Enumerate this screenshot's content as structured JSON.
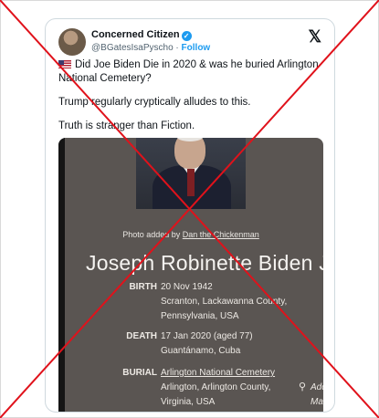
{
  "tweet": {
    "display_name": "Concerned Citizen",
    "handle": "@BGatesIsaPyscho",
    "separator": "·",
    "follow_label": "Follow",
    "lines": [
      "Did Joe Biden Die in 2020 & was he buried Arlington National Cemetery?",
      "Trump regularly cryptically alludes to this.",
      "Truth is stranger than Fiction."
    ]
  },
  "embed": {
    "photo_credit_prefix": "Photo added by",
    "photo_credit_name": "Dan the Chickenman",
    "person_name": "Joseph Robinette Biden Jr.",
    "birth_label": "BIRTH",
    "birth_date": "20 Nov 1942",
    "birth_place": "Scranton, Lackawanna County, Pennsylvania, USA",
    "death_label": "DEATH",
    "death_date": "17 Jan 2020 (aged 77)",
    "death_place": "Guantánamo, Cuba",
    "burial_label": "BURIAL",
    "burial_site": "Arlington National Cemetery",
    "burial_place": "Arlington, Arlington County, Virginia, USA",
    "add_link": "Add Man"
  },
  "colors": {
    "accent": "#1d9bf0",
    "overlay_x": "#e0121b"
  }
}
